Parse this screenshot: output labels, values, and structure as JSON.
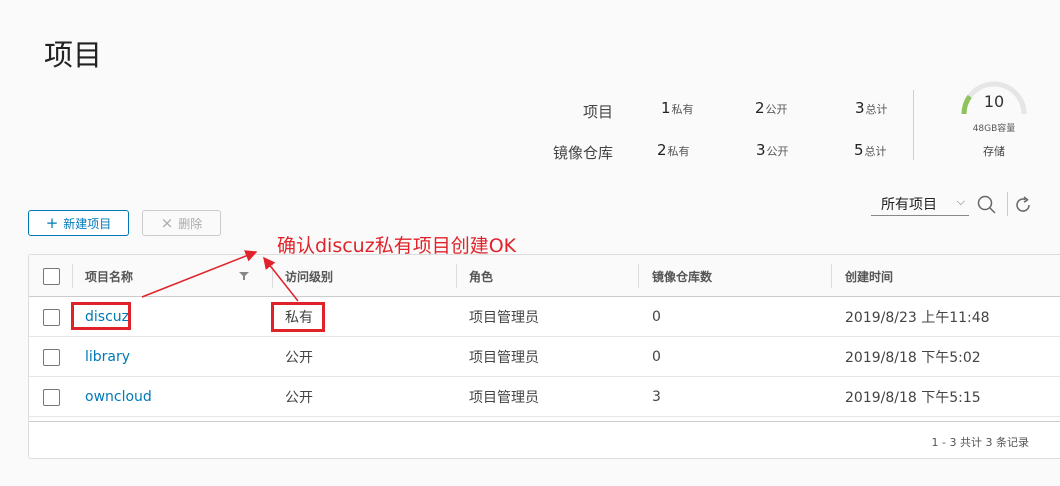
{
  "page": {
    "title": "项目"
  },
  "summary": {
    "rows": [
      {
        "label": "项目",
        "private": "1",
        "public": "2",
        "total": "3"
      },
      {
        "label": "镜像仓库",
        "private": "2",
        "public": "3",
        "total": "5"
      }
    ],
    "units": {
      "private": "私有",
      "public": "公开",
      "total": "总计"
    },
    "storage": {
      "value": "10",
      "caption": "48GB容量",
      "label": "存储",
      "fill_fraction": 0.2,
      "fill_color": "#8fc25c"
    }
  },
  "toolbar": {
    "new_label": "新建项目",
    "delete_label": "删除",
    "filter": {
      "selected": "所有项目"
    }
  },
  "table": {
    "headers": [
      "项目名称",
      "访问级别",
      "角色",
      "镜像仓库数",
      "创建时间"
    ],
    "rows": [
      {
        "name": "discuz",
        "access": "私有",
        "role": "项目管理员",
        "repos": "0",
        "created": "2019/8/23 上午11:48"
      },
      {
        "name": "library",
        "access": "公开",
        "role": "项目管理员",
        "repos": "0",
        "created": "2019/8/18 下午5:02"
      },
      {
        "name": "owncloud",
        "access": "公开",
        "role": "项目管理员",
        "repos": "3",
        "created": "2019/8/18 下午5:15"
      }
    ],
    "footer": "1 - 3 共计 3 条记录"
  },
  "annotation": {
    "text": "确认discuz私有项目创建OK",
    "color": "#e0232a"
  },
  "colors": {
    "accent": "#0079b8"
  }
}
